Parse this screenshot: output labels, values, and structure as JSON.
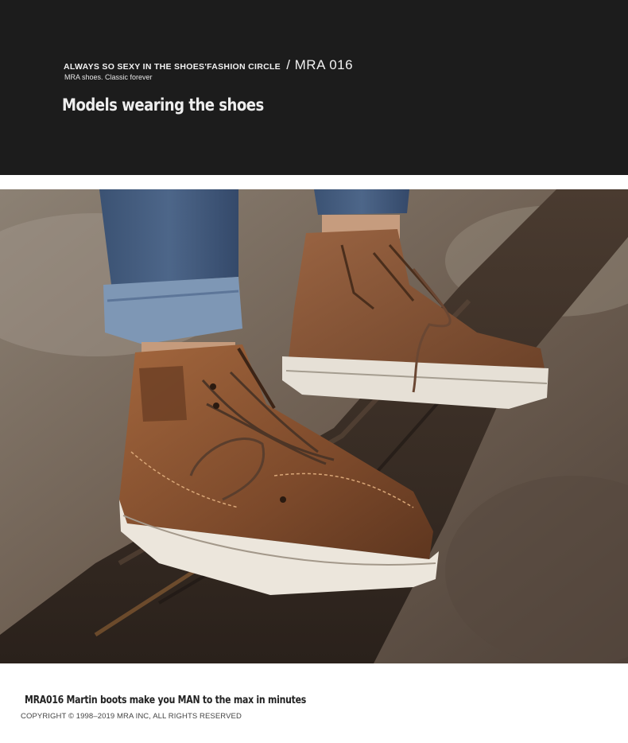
{
  "header": {
    "tagline": "ALWAYS SO SEXY IN THE SHOES'FASHION CIRCLE",
    "code": "/ MRA 016",
    "subline": "MRA shoes. Classic forever",
    "title": "Models wearing the shoes"
  },
  "photo": {
    "subject": "boots-on-log-photo"
  },
  "footer": {
    "caption": "MRA016 Martin boots make you MAN to the max in minutes",
    "copyright": "COPYRIGHT © 1998–2019 MRA INC,  ALL RIGHTS RESERVED"
  },
  "colors": {
    "header_bg": "#1c1c1c",
    "leather": "#8a5532",
    "sole": "#e8e2d8",
    "denim": "#5a7396",
    "wood": "#3a2e25"
  }
}
